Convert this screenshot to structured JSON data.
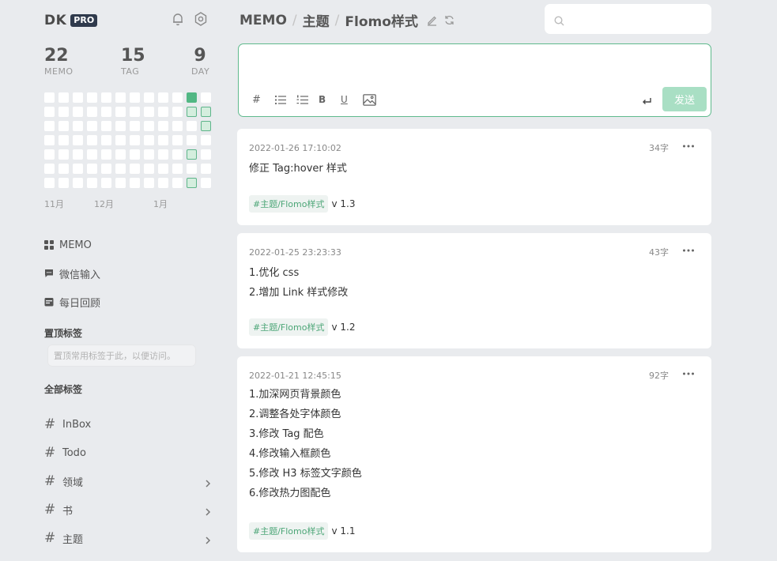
{
  "brand": {
    "name": "DK",
    "badge": "PRO"
  },
  "icons": {
    "bell": "bell-icon",
    "settings": "gear-icon",
    "search": "search-icon"
  },
  "stats": [
    {
      "value": "22",
      "label": "MEMO"
    },
    {
      "value": "15",
      "label": "TAG"
    },
    {
      "value": "9",
      "label": "DAY"
    }
  ],
  "heatmap": {
    "active_cells": [
      {
        "col": 10,
        "row": 0,
        "level": 3
      },
      {
        "col": 10,
        "row": 1,
        "level": 1
      },
      {
        "col": 11,
        "row": 1,
        "level": 1
      },
      {
        "col": 11,
        "row": 2,
        "level": 1
      },
      {
        "col": 10,
        "row": 4,
        "level": 1
      },
      {
        "col": 10,
        "row": 6,
        "level": 1
      }
    ],
    "months": [
      "11月",
      "12月",
      "1月"
    ]
  },
  "nav": [
    {
      "label": "MEMO",
      "icon": "grid-icon"
    },
    {
      "label": "微信输入",
      "icon": "wechat-message-icon"
    },
    {
      "label": "每日回顾",
      "icon": "calendar-review-icon"
    }
  ],
  "pinned": {
    "title": "置顶标签",
    "placeholder": "置顶常用标签于此，以便访问。"
  },
  "all_tags": {
    "title": "全部标签",
    "items": [
      {
        "label": "InBox",
        "has_children": false
      },
      {
        "label": "Todo",
        "has_children": false
      },
      {
        "label": "领域",
        "has_children": true
      },
      {
        "label": "书",
        "has_children": true
      },
      {
        "label": "主题",
        "has_children": true
      }
    ]
  },
  "breadcrumb": [
    "MEMO",
    "主题",
    "Flomo样式"
  ],
  "search": {
    "placeholder": ""
  },
  "editor": {
    "placeholder": "",
    "send_label": "发送",
    "bold_label": "B",
    "underline_label": "U",
    "hash_label": "#"
  },
  "memos": [
    {
      "time": "2022-01-26 17:10:02",
      "count": "34字",
      "lines": [
        "修正 Tag:hover 样式"
      ],
      "tag": "#主题/Flomo样式",
      "version": "v 1.3"
    },
    {
      "time": "2022-01-25 23:23:33",
      "count": "43字",
      "lines": [
        "1.优化 css",
        "2.增加 Link 样式修改"
      ],
      "tag": "#主题/Flomo样式",
      "version": "v 1.2"
    },
    {
      "time": "2022-01-21 12:45:15",
      "count": "92字",
      "lines": [
        "1.加深网页背景颜色",
        "2.调整各处字体颜色",
        "3.修改 Tag 配色",
        "4.修改输入框颜色",
        "5.修改 H3 标签文字颜色",
        "6.修改热力图配色"
      ],
      "tag": "#主题/Flomo样式",
      "version": "v 1.1"
    }
  ]
}
